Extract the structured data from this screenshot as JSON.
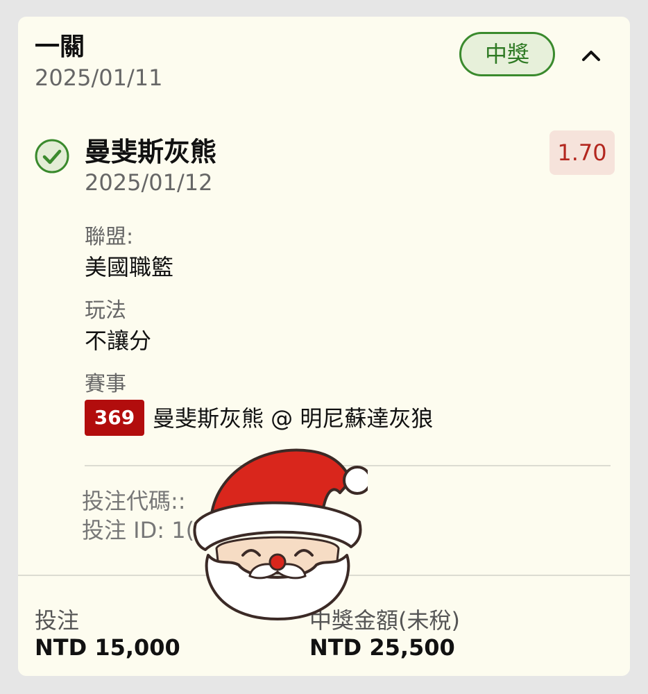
{
  "header": {
    "bet_type": "一關",
    "bet_date": "2025/01/11",
    "status": "中獎",
    "collapse_icon": "chevron-up-icon"
  },
  "selection": {
    "result_icon": "check-circle-icon",
    "team": "曼斐斯灰熊",
    "match_date": "2025/01/12",
    "odds": "1.70",
    "league_label": "聯盟:",
    "league_value": "美國職籃",
    "play_label": "玩法",
    "play_value": "不讓分",
    "event_label": "賽事",
    "event_code": "369",
    "event_name": "曼斐斯灰熊 @ 明尼蘇達灰狼"
  },
  "details": {
    "bet_code": "投注代碼::",
    "bet_id": "投注 ID: 1("
  },
  "footer": {
    "stake_label": "投注",
    "stake_value": "NTD 15,000",
    "win_label": "中獎金額(未稅)",
    "win_value": "NTD 25,500"
  },
  "sticker": "santa-claus-icon",
  "colors": {
    "background": "#fdfcef",
    "win_green": "#3a8a2d",
    "odds_red": "#b3261e",
    "event_code_red": "#b20d0d"
  }
}
